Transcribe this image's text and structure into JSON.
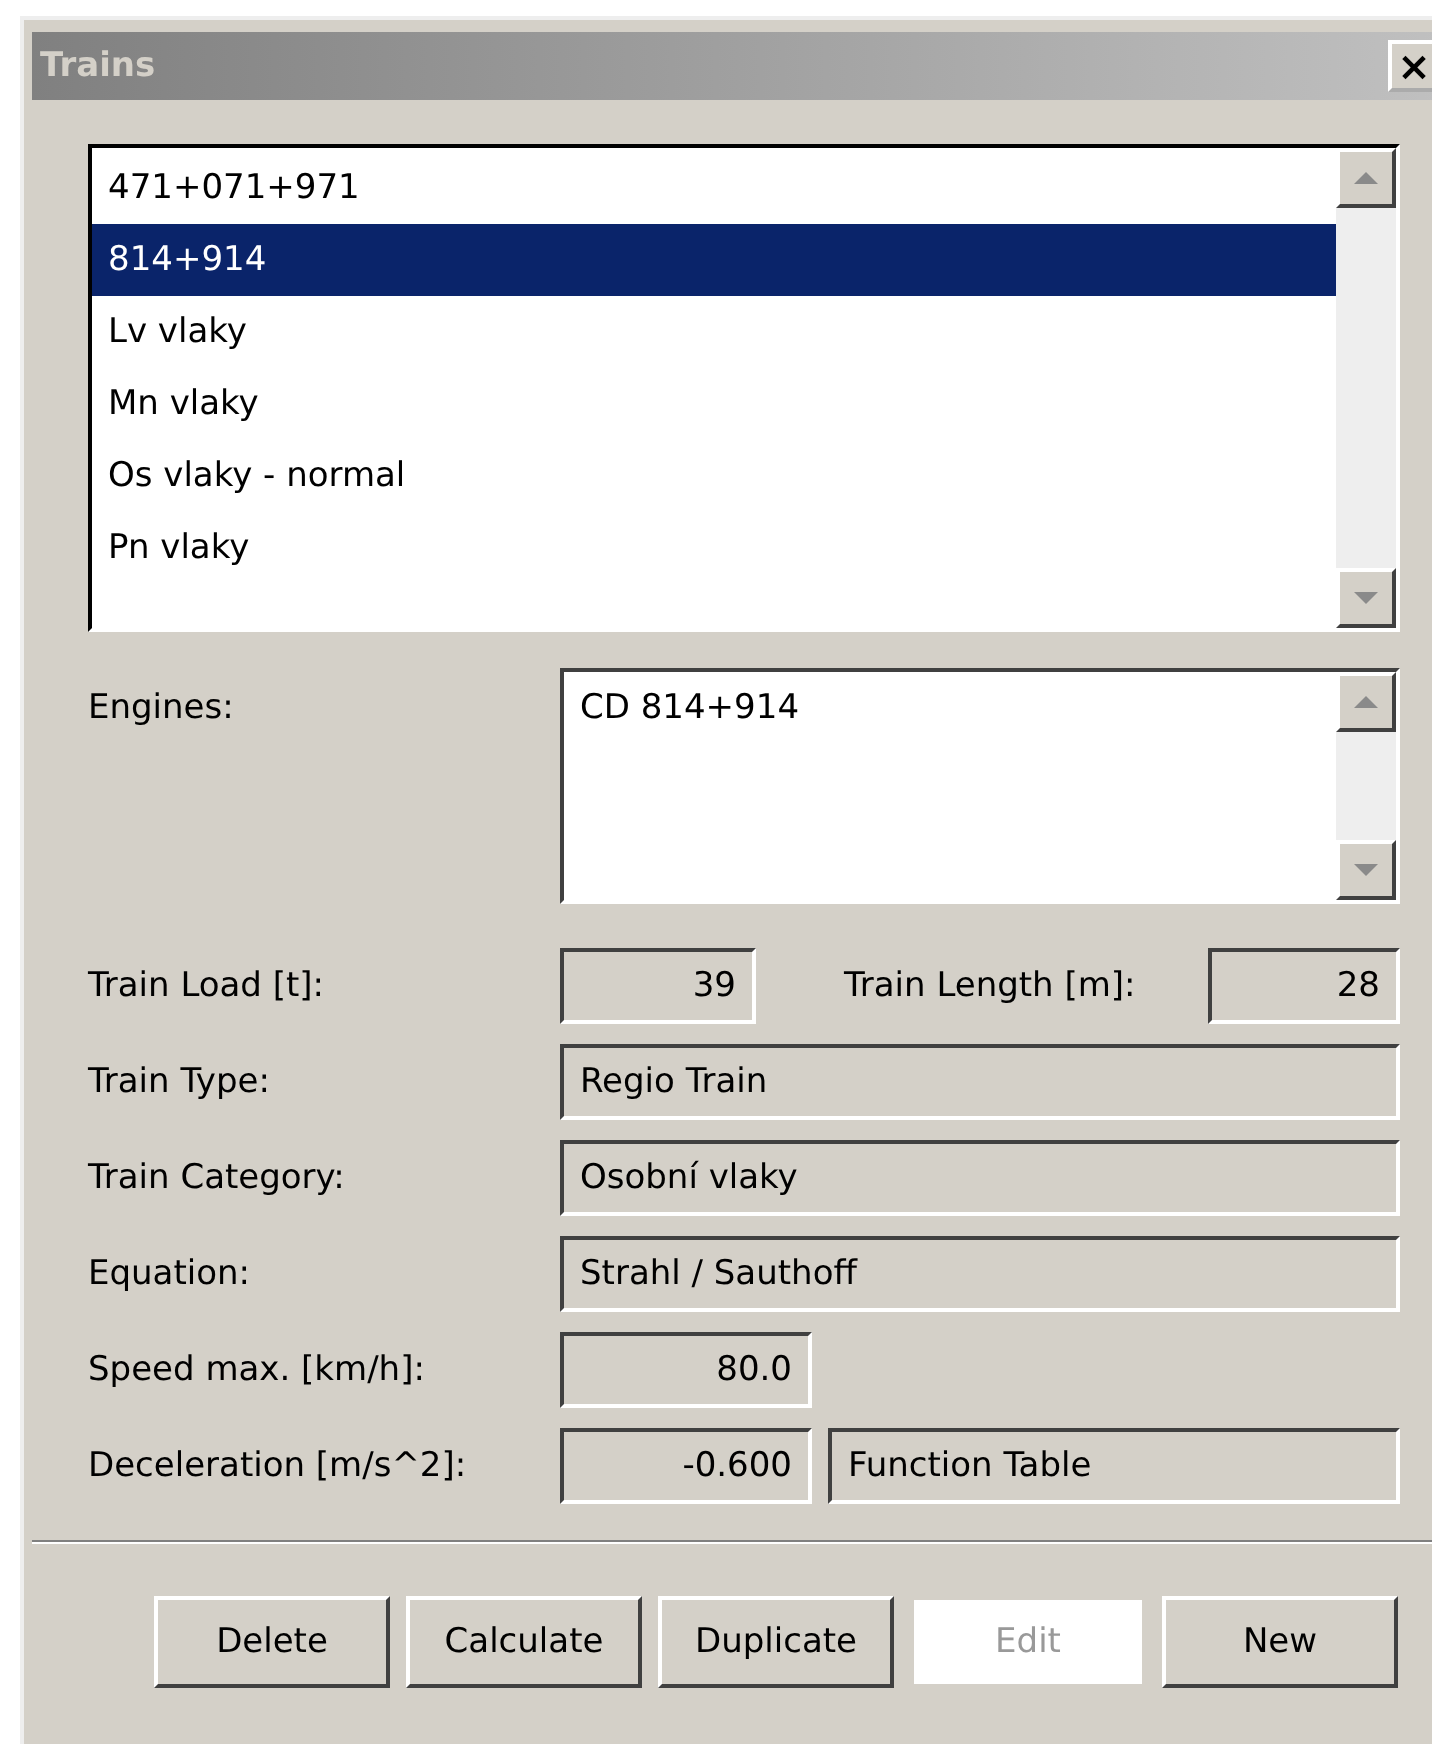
{
  "window": {
    "title": "Trains",
    "close": "×"
  },
  "trains": [
    {
      "label": "471+071+971",
      "selected": false
    },
    {
      "label": "814+914",
      "selected": true
    },
    {
      "label": "Lv vlaky",
      "selected": false
    },
    {
      "label": "Mn vlaky",
      "selected": false
    },
    {
      "label": "Os vlaky - normal",
      "selected": false
    },
    {
      "label": "Pn vlaky",
      "selected": false
    }
  ],
  "engines": {
    "label": "Engines:",
    "items": [
      "CD 814+914"
    ]
  },
  "fields": [
    {
      "kind": "pair",
      "label": "Train Load [t]:",
      "value": "39",
      "label_2": "Train Length [m]:",
      "value_2": "28"
    },
    {
      "kind": "wide",
      "label": "Train Type:",
      "value": "Regio Train"
    },
    {
      "kind": "wide",
      "label": "Train Category:",
      "value": "Osobní vlaky"
    },
    {
      "kind": "wide",
      "label": "Equation:",
      "value": "Strahl / Sauthoff"
    },
    {
      "kind": "short",
      "label": "Speed max. [km/h]:",
      "value": "80.0"
    },
    {
      "kind": "split",
      "label": "Deceleration [m/s^2]:",
      "value": "-0.600",
      "value_2": "Function Table"
    }
  ],
  "buttons": [
    {
      "label": "Delete",
      "disabled": false
    },
    {
      "label": "Calculate",
      "disabled": false
    },
    {
      "label": "Duplicate",
      "disabled": false
    },
    {
      "label": "Edit",
      "disabled": true
    },
    {
      "label": "New",
      "disabled": false
    }
  ]
}
